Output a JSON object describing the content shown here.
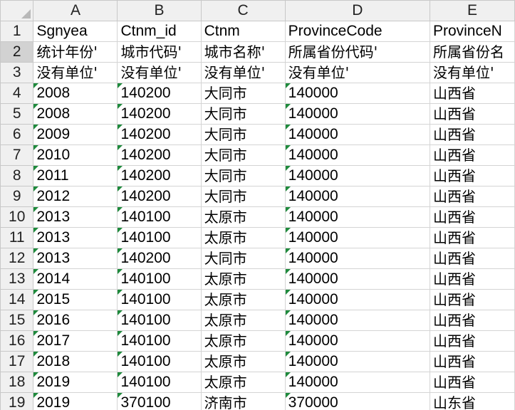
{
  "columns": [
    "A",
    "B",
    "C",
    "D",
    "E"
  ],
  "rows": [
    {
      "num": "1",
      "cells": [
        "Sgnyea",
        "Ctnm_id",
        "Ctnm",
        "ProvinceCode",
        "ProvinceN"
      ],
      "flag": false
    },
    {
      "num": "2",
      "cells": [
        "统计年份'",
        "城市代码'",
        "城市名称'",
        "所属省份代码'",
        "所属省份名"
      ],
      "flag": false
    },
    {
      "num": "3",
      "cells": [
        "没有单位'",
        "没有单位'",
        "没有单位'",
        "没有单位'",
        "没有单位'"
      ],
      "flag": false
    },
    {
      "num": "4",
      "cells": [
        "2008",
        "140200",
        "大同市",
        "140000",
        "山西省"
      ],
      "flag": true
    },
    {
      "num": "5",
      "cells": [
        "2008",
        "140200",
        "大同市",
        "140000",
        "山西省"
      ],
      "flag": true
    },
    {
      "num": "6",
      "cells": [
        "2009",
        "140200",
        "大同市",
        "140000",
        "山西省"
      ],
      "flag": true
    },
    {
      "num": "7",
      "cells": [
        "2010",
        "140200",
        "大同市",
        "140000",
        "山西省"
      ],
      "flag": true
    },
    {
      "num": "8",
      "cells": [
        "2011",
        "140200",
        "大同市",
        "140000",
        "山西省"
      ],
      "flag": true
    },
    {
      "num": "9",
      "cells": [
        "2012",
        "140200",
        "大同市",
        "140000",
        "山西省"
      ],
      "flag": true
    },
    {
      "num": "10",
      "cells": [
        "2013",
        "140100",
        "太原市",
        "140000",
        "山西省"
      ],
      "flag": true
    },
    {
      "num": "11",
      "cells": [
        "2013",
        "140100",
        "太原市",
        "140000",
        "山西省"
      ],
      "flag": true
    },
    {
      "num": "12",
      "cells": [
        "2013",
        "140200",
        "大同市",
        "140000",
        "山西省"
      ],
      "flag": true
    },
    {
      "num": "13",
      "cells": [
        "2014",
        "140100",
        "太原市",
        "140000",
        "山西省"
      ],
      "flag": true
    },
    {
      "num": "14",
      "cells": [
        "2015",
        "140100",
        "太原市",
        "140000",
        "山西省"
      ],
      "flag": true
    },
    {
      "num": "15",
      "cells": [
        "2016",
        "140100",
        "太原市",
        "140000",
        "山西省"
      ],
      "flag": true
    },
    {
      "num": "16",
      "cells": [
        "2017",
        "140100",
        "太原市",
        "140000",
        "山西省"
      ],
      "flag": true
    },
    {
      "num": "17",
      "cells": [
        "2018",
        "140100",
        "太原市",
        "140000",
        "山西省"
      ],
      "flag": true
    },
    {
      "num": "18",
      "cells": [
        "2019",
        "140100",
        "太原市",
        "140000",
        "山西省"
      ],
      "flag": true
    },
    {
      "num": "19",
      "cells": [
        "2019",
        "370100",
        "济南市",
        "370000",
        "山东省"
      ],
      "flag": true
    }
  ],
  "selected_row": "2",
  "colors": {
    "flag": "#1e8a3c",
    "header_bg": "#f0f0f0",
    "selected_header_bg": "#d2d2d2",
    "grid": "#d4d4d4"
  }
}
